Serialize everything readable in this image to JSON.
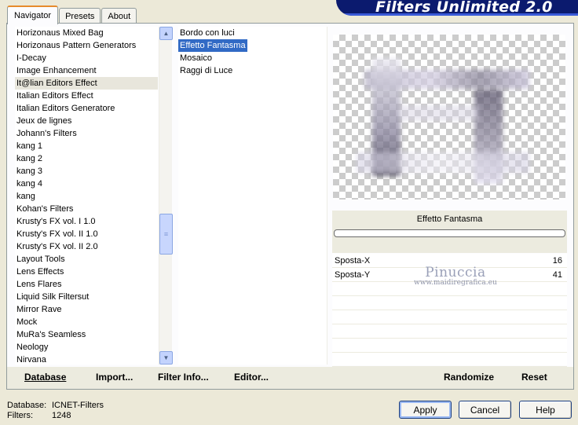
{
  "banner": {
    "title": "Filters Unlimited 2.0"
  },
  "tabs": [
    {
      "label": "Navigator",
      "active": true
    },
    {
      "label": "Presets",
      "active": false
    },
    {
      "label": "About",
      "active": false
    }
  ],
  "categories": {
    "items": [
      "Horizonaus Mixed Bag",
      "Horizonaus Pattern Generators",
      "I-Decay",
      "Image Enhancement",
      "It@lian Editors Effect",
      "Italian Editors Effect",
      "Italian Editors Generatore",
      "Jeux de lignes",
      "Johann's Filters",
      "kang 1",
      "kang 2",
      "kang 3",
      "kang 4",
      "kang",
      "Kohan's Filters",
      "Krusty's FX vol. I 1.0",
      "Krusty's FX vol. II 1.0",
      "Krusty's FX vol. II 2.0",
      "Layout Tools",
      "Lens Effects",
      "Lens Flares",
      "Liquid Silk Filtersut",
      "Mirror Rave",
      "Mock",
      "MuRa's Seamless",
      "Neology",
      "Nirvana"
    ],
    "selected_index": 4
  },
  "filters": {
    "items": [
      "Bordo con luci",
      "Effetto Fantasma",
      "Mosaico",
      "Raggi di Luce"
    ],
    "selected_index": 1
  },
  "preview": {
    "effect_name": "Effetto Fantasma"
  },
  "params": [
    {
      "name": "Sposta-X",
      "value": "16"
    },
    {
      "name": "Sposta-Y",
      "value": "41"
    }
  ],
  "watermark": {
    "name": "Pinuccia",
    "url": "www.maidiregrafica.eu"
  },
  "links": {
    "database": "Database",
    "import": "Import...",
    "filter_info": "Filter Info...",
    "editor": "Editor...",
    "randomize": "Randomize",
    "reset": "Reset"
  },
  "status": {
    "database_label": "Database:",
    "database_value": "ICNET-Filters",
    "filters_label": "Filters:",
    "filters_value": "1248"
  },
  "buttons": {
    "apply": "Apply",
    "cancel": "Cancel",
    "help": "Help"
  },
  "colors": {
    "selection": "#316ac5",
    "banner": "#0b1a6e",
    "tab_accent": "#e68b2c"
  }
}
